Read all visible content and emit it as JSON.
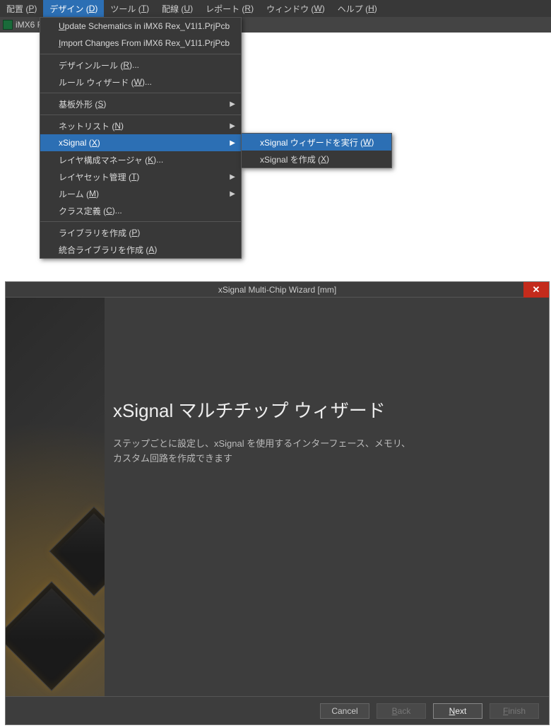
{
  "menubar": {
    "items": [
      {
        "label": "配置 (",
        "mn": "P",
        "suffix": ")"
      },
      {
        "label": "デザイン (",
        "mn": "D",
        "suffix": ")",
        "active": true
      },
      {
        "label": "ツール (",
        "mn": "T",
        "suffix": ")"
      },
      {
        "label": "配線 (",
        "mn": "U",
        "suffix": ")"
      },
      {
        "label": "レポート (",
        "mn": "R",
        "suffix": ")"
      },
      {
        "label": "ウィンドウ (",
        "mn": "W",
        "suffix": ")"
      },
      {
        "label": "ヘルプ (",
        "mn": "H",
        "suffix": ")"
      }
    ]
  },
  "tab": {
    "label": "iMX6 R"
  },
  "design_menu": {
    "items": [
      {
        "pre": "",
        "mn": "U",
        "post": "pdate Schematics in iMX6 Rex_V1I1.PrjPcb"
      },
      {
        "pre": "",
        "mn": "I",
        "post": "mport Changes From iMX6 Rex_V1I1.PrjPcb"
      },
      {
        "sep": true
      },
      {
        "pre": "デザインルール (",
        "mn": "R",
        "post": ")..."
      },
      {
        "pre": "ルール ウィザード (",
        "mn": "W",
        "post": ")..."
      },
      {
        "sep": true
      },
      {
        "pre": "基板外形 (",
        "mn": "S",
        "post": ")",
        "arrow": true
      },
      {
        "sep": true
      },
      {
        "pre": "ネットリスト (",
        "mn": "N",
        "post": ")",
        "arrow": true
      },
      {
        "pre": "xSignal (",
        "mn": "X",
        "post": ")",
        "arrow": true,
        "highlight": true
      },
      {
        "pre": "レイヤ構成マネージャ (",
        "mn": "K",
        "post": ")..."
      },
      {
        "pre": "レイヤセット管理 (",
        "mn": "T",
        "post": ")",
        "arrow": true
      },
      {
        "pre": "ルーム (",
        "mn": "M",
        "post": ")",
        "arrow": true
      },
      {
        "pre": "クラス定義 (",
        "mn": "C",
        "post": ")..."
      },
      {
        "sep": true
      },
      {
        "pre": "ライブラリを作成 (",
        "mn": "P",
        "post": ")"
      },
      {
        "pre": "統合ライブラリを作成 (",
        "mn": "A",
        "post": ")"
      }
    ]
  },
  "xsignal_submenu": {
    "items": [
      {
        "pre": "xSignal ウィザードを実行 (",
        "mn": "W",
        "post": ")",
        "highlight": true
      },
      {
        "pre": "xSignal を作成 (",
        "mn": "X",
        "post": ")"
      }
    ]
  },
  "wizard": {
    "title": "xSignal Multi-Chip Wizard [mm]",
    "heading": "xSignal マルチチップ ウィザード",
    "desc_line1": "ステップごとに設定し、xSignal を使用するインターフェース、メモリ、",
    "desc_line2": "カスタム回路を作成できます",
    "buttons": {
      "cancel": "Cancel",
      "back_mn": "B",
      "back_post": "ack",
      "next_mn": "N",
      "next_post": "ext",
      "finish_mn": "F",
      "finish_post": "inish"
    }
  }
}
